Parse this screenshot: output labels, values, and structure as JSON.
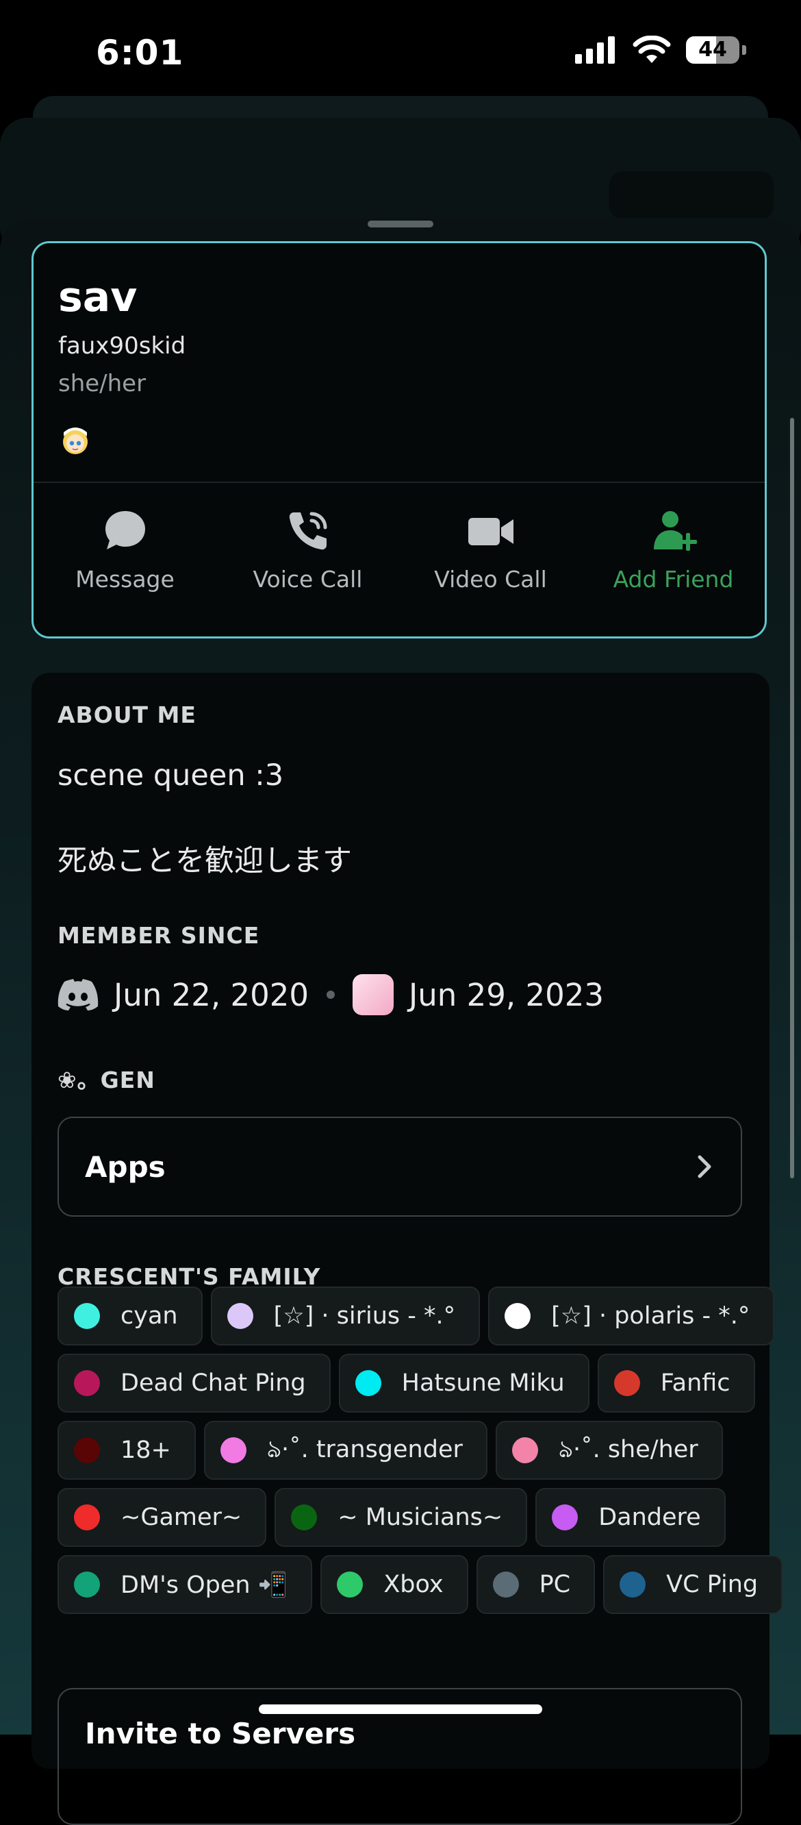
{
  "status_bar": {
    "time": "6:01",
    "battery": "44"
  },
  "profile": {
    "display_name": "sav",
    "username": "faux90skid",
    "pronouns": "she/her"
  },
  "actions": [
    {
      "label": "Message",
      "icon": "chat-bubble-icon"
    },
    {
      "label": "Voice Call",
      "icon": "phone-icon"
    },
    {
      "label": "Video Call",
      "icon": "video-camera-icon"
    },
    {
      "label": "Add Friend",
      "icon": "add-friend-icon"
    }
  ],
  "about": {
    "heading": "ABOUT ME",
    "line1": "scene queen :3",
    "line2": "死ぬことを歓迎します"
  },
  "member_since": {
    "heading": "MEMBER SINCE",
    "discord_date": "Jun 22, 2020",
    "server_date": "Jun 29, 2023"
  },
  "gen": {
    "heading": "❀。GEN",
    "apps_label": "Apps"
  },
  "roles_section": {
    "heading": "CRESCENT'S FAMILY",
    "rows": [
      [
        {
          "name": "cyan",
          "color": "#3ff0e0"
        },
        {
          "name": "[☆] · sirius - *.°",
          "color": "#dcc8f8"
        },
        {
          "name": "[☆] · polaris - *.°",
          "color": "#ffffff"
        }
      ],
      [
        {
          "name": "Dead Chat Ping",
          "color": "#b8185a"
        },
        {
          "name": "Hatsune Miku",
          "color": "#00eaf2"
        },
        {
          "name": "Fanfic",
          "color": "#d6392c"
        }
      ],
      [
        {
          "name": "18+",
          "color": "#5a0505"
        },
        {
          "name": "ঌ·˚. transgender",
          "color": "#f27ae3"
        },
        {
          "name": "ঌ·˚. she/her",
          "color": "#f383a8"
        }
      ],
      [
        {
          "name": "~Gamer~",
          "color": "#ef2b2b"
        },
        {
          "name": "~ Musicians~",
          "color": "#0a6512"
        },
        {
          "name": "Dandere",
          "color": "#c65cf2"
        }
      ],
      [
        {
          "name": "DM's Open 📲",
          "color": "#12a378"
        },
        {
          "name": "Xbox",
          "color": "#2ec96a"
        },
        {
          "name": "PC",
          "color": "#5a6c76"
        },
        {
          "name": "VC Ping",
          "color": "#1e6290"
        }
      ]
    ]
  },
  "invite": {
    "label": "Invite to Servers"
  }
}
